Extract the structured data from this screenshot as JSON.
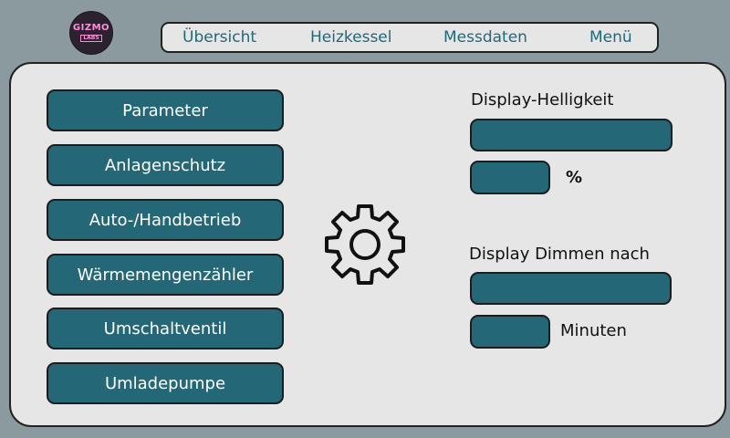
{
  "logo": {
    "top_text": "GIZMO",
    "bottom_text": "LABS"
  },
  "nav": {
    "items": [
      "Übersicht",
      "Heizkessel",
      "Messdaten",
      "Menü"
    ]
  },
  "menu": {
    "buttons": [
      "Parameter",
      "Anlagenschutz",
      "Auto-/Handbetrieb",
      "Wärmemengenzähler",
      "Umschaltventil",
      "Umladepumpe"
    ]
  },
  "settings_icon": "gear-icon",
  "display": {
    "brightness_label": "Display-Helligkeit",
    "brightness_unit": "%",
    "dim_label": "Display Dimmen nach",
    "dim_unit": "Minuten"
  },
  "colors": {
    "accent": "#246877",
    "nav_text": "#1f6a78",
    "background": "#8a9a9f",
    "panel": "#e6e6e6"
  }
}
